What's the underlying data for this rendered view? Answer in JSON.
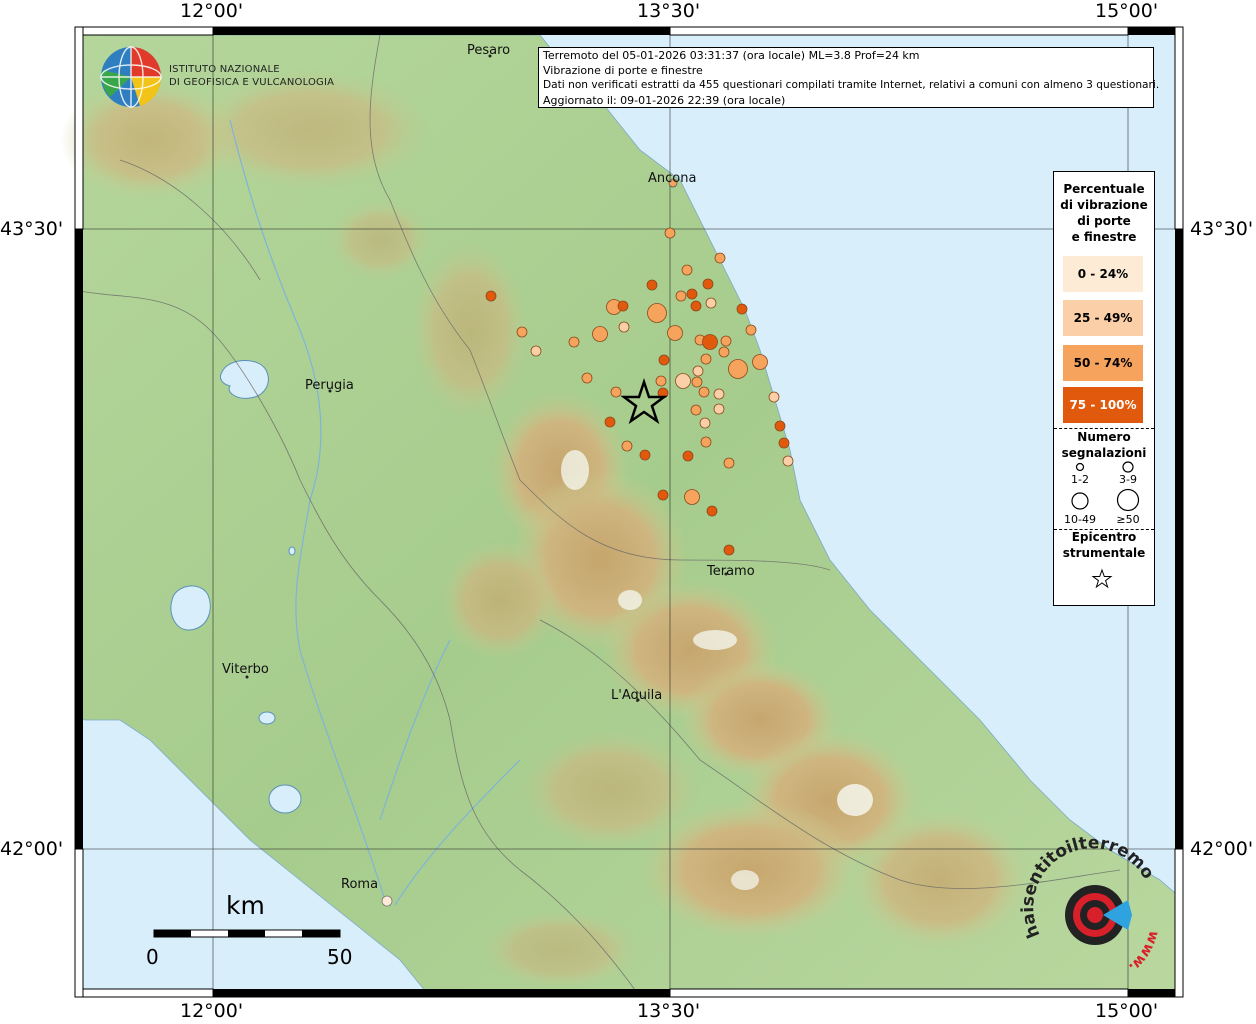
{
  "info": {
    "line1": "Terremoto del 05-01-2026 03:31:37 (ora locale) ML=3.8 Prof=24 km",
    "line2": "Vibrazione di porte e finestre",
    "line3": "Dati non verificati estratti da 455 questionari compilati tramite Internet, relativi a comuni con almeno 3 questionari.",
    "line4": "Aggiornato il: 09-01-2026 22:39 (ora locale)"
  },
  "logo": {
    "line1": "ISTITUTO NAZIONALE",
    "line2": "DI GEOFISICA E VULCANOLOGIA"
  },
  "axis": {
    "lon_top": [
      "12°00'",
      "13°30'",
      "15°00'"
    ],
    "lon_bottom": [
      "12°00'",
      "13°30'",
      "15°00'"
    ],
    "lat_left": [
      "43°30'",
      "42°00'"
    ],
    "lat_right": [
      "43°30'",
      "42°00'"
    ]
  },
  "cities": [
    "Pesaro",
    "Ancona",
    "Perugia",
    "Teramo",
    "Viterbo",
    "L'Aquila",
    "Roma"
  ],
  "legend": {
    "title": "Percentuale di vibrazione di porte e finestre",
    "title_lines": [
      "Percentuale",
      "di vibrazione",
      "di porte",
      "e finestre"
    ],
    "classes": [
      {
        "label": "0 - 24%",
        "color": "#fdebd6"
      },
      {
        "label": "25 - 49%",
        "color": "#fbd0a8"
      },
      {
        "label": "50 - 74%",
        "color": "#f6a35e"
      },
      {
        "label": "75 - 100%",
        "color": "#e1590c"
      }
    ],
    "count_title_lines": [
      "Numero",
      "segnalazioni"
    ],
    "count_labels": [
      "1-2",
      "3-9",
      "10-49",
      "≥50"
    ],
    "epi_title_lines": [
      "Epicentro",
      "strumentale"
    ]
  },
  "scale": {
    "unit": "km",
    "min": "0",
    "max": "50"
  },
  "watermark": {
    "text": "haisentitoilterremoto.it",
    "prefix": "www."
  },
  "colors": {
    "sea": "#d9eefb",
    "land": "#a9cf92",
    "frame": "#000000"
  },
  "map_data": {
    "epicenter": {
      "lon": 13.42,
      "lat": 43.18
    },
    "points_note": "questionnaire municipalities plotted by vibration class and report count"
  }
}
